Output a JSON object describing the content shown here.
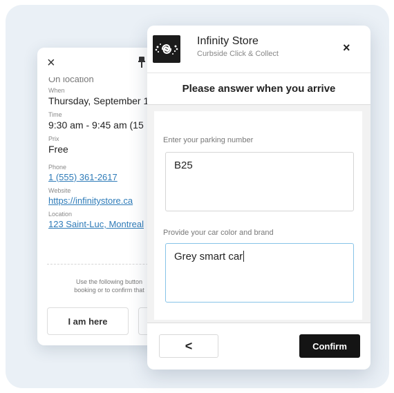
{
  "back_card": {
    "close_glyph": "×",
    "cut_text": "On location",
    "when_label": "When",
    "when_value": "Thursday, September 1",
    "time_label": "Time",
    "time_value": "9:30 am - 9:45 am (15",
    "price_label": "Prix",
    "price_value": "Free",
    "phone_label": "Phone",
    "phone_value": "1 (555) 361-2617",
    "website_label": "Website",
    "website_value": "https://infinitystore.ca",
    "location_label": "Location",
    "location_value": "123 Saint-Luc, Montreal",
    "note_line1": "Use the following button",
    "note_line2": "booking or to confirm that",
    "button_label": "I am here"
  },
  "modal": {
    "store_name": "Infinity Store",
    "store_subtitle": "Curbside Click & Collect",
    "close_glyph": "×",
    "prompt": "Please answer when you arrive",
    "fields": [
      {
        "label": "Enter your parking number",
        "value": "B25"
      },
      {
        "label": "Provide your car color and brand",
        "value": "Grey smart car"
      }
    ],
    "back_glyph": "<",
    "confirm_label": "Confirm"
  },
  "colors": {
    "page_bg": "#eaf0f6",
    "link": "#2e7bb8",
    "confirm_bg": "#141414",
    "focus_border": "#86c3e8"
  },
  "icons": [
    "close-icon",
    "pin-icon",
    "store-logo-icon",
    "chevron-left-icon"
  ]
}
